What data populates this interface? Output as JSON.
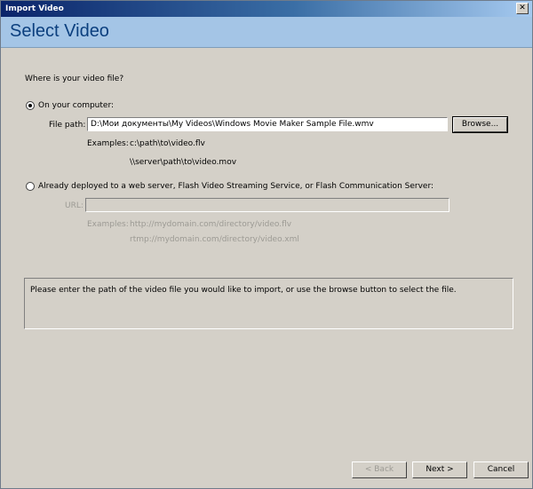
{
  "window": {
    "title": "Import Video",
    "close_glyph": "✕"
  },
  "header": {
    "title": "Select Video"
  },
  "question": "Where is your video file?",
  "option_computer": {
    "label": "On your computer:",
    "selected": true,
    "file_path_label": "File path:",
    "file_path_value": "D:\\Мои документы\\My Videos\\Windows Movie Maker Sample File.wmv",
    "browse_label": "Browse...",
    "examples_label": "Examples:",
    "examples": [
      "c:\\path\\to\\video.flv",
      "\\\\server\\path\\to\\video.mov"
    ]
  },
  "option_web": {
    "label": "Already deployed to a web server, Flash Video Streaming Service, or Flash Communication Server:",
    "selected": false,
    "url_label": "URL:",
    "url_value": "",
    "examples_label": "Examples:",
    "examples": [
      "http://mydomain.com/directory/video.flv",
      "rtmp://mydomain.com/directory/video.xml"
    ]
  },
  "info_message": "Please enter the path of the video file you would like to import, or use the browse button to select the file.",
  "footer": {
    "back_label": "< Back",
    "next_label": "Next >",
    "cancel_label": "Cancel"
  },
  "colors": {
    "header_background": "#a4c5e6",
    "header_title": "#0b3f7e",
    "dialog_background": "#d4d0c8"
  }
}
